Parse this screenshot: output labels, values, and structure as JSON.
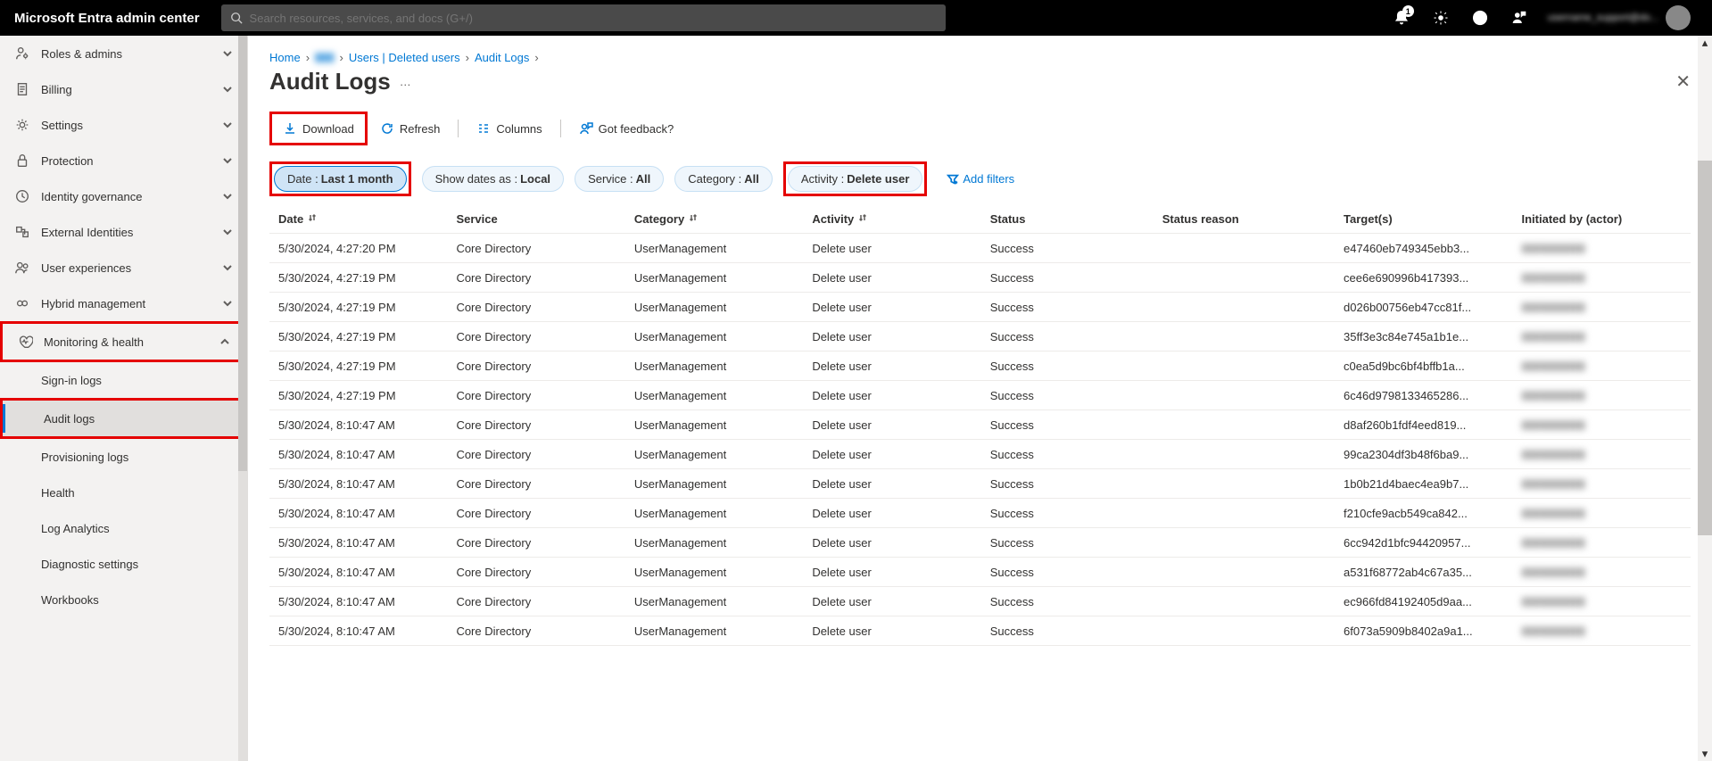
{
  "app_title": "Microsoft Entra admin center",
  "search_placeholder": "Search resources, services, and docs (G+/)",
  "notification_count": "1",
  "sidebar": {
    "items": [
      {
        "label": "Roles & admins",
        "icon": "user-gear",
        "expandable": true
      },
      {
        "label": "Billing",
        "icon": "receipt",
        "expandable": true
      },
      {
        "label": "Settings",
        "icon": "gear",
        "expandable": true
      },
      {
        "label": "Protection",
        "icon": "lock",
        "expandable": true
      },
      {
        "label": "Identity governance",
        "icon": "gavel",
        "expandable": true
      },
      {
        "label": "External Identities",
        "icon": "org",
        "expandable": true
      },
      {
        "label": "User experiences",
        "icon": "users",
        "expandable": true
      },
      {
        "label": "Hybrid management",
        "icon": "hybrid",
        "expandable": true
      },
      {
        "label": "Monitoring & health",
        "icon": "heartbeat",
        "expandable": true,
        "expanded": true,
        "highlighted": true
      },
      {
        "label": "Sign-in logs",
        "sub": true
      },
      {
        "label": "Audit logs",
        "sub": true,
        "selected": true,
        "highlighted": true
      },
      {
        "label": "Provisioning logs",
        "sub": true
      },
      {
        "label": "Health",
        "sub": true
      },
      {
        "label": "Log Analytics",
        "sub": true
      },
      {
        "label": "Diagnostic settings",
        "sub": true
      },
      {
        "label": "Workbooks",
        "sub": true
      }
    ]
  },
  "breadcrumb": [
    {
      "label": "Home"
    },
    {
      "label": "▮▮▮",
      "blurred": true
    },
    {
      "label": "Users | Deleted users"
    },
    {
      "label": "Audit Logs"
    }
  ],
  "page_title": "Audit Logs",
  "toolbar": {
    "download": "Download",
    "refresh": "Refresh",
    "columns": "Columns",
    "feedback": "Got feedback?"
  },
  "filters": {
    "date": {
      "label": "Date : ",
      "value": "Last 1 month",
      "highlighted": true
    },
    "show_dates": {
      "label": "Show dates as : ",
      "value": "Local"
    },
    "service": {
      "label": "Service : ",
      "value": "All"
    },
    "category": {
      "label": "Category : ",
      "value": "All"
    },
    "activity": {
      "label": "Activity : ",
      "value": "Delete user",
      "highlighted": true
    },
    "add": "Add filters"
  },
  "table": {
    "headers": [
      "Date",
      "Service",
      "Category",
      "Activity",
      "Status",
      "Status reason",
      "Target(s)",
      "Initiated by (actor)"
    ],
    "rows": [
      {
        "date": "5/30/2024, 4:27:20 PM",
        "service": "Core Directory",
        "category": "UserManagement",
        "activity": "Delete user",
        "status": "Success",
        "reason": "",
        "target": "e47460eb749345ebb3...",
        "actor": "▮▮▮▮▮▮▮▮▮▮"
      },
      {
        "date": "5/30/2024, 4:27:19 PM",
        "service": "Core Directory",
        "category": "UserManagement",
        "activity": "Delete user",
        "status": "Success",
        "reason": "",
        "target": "cee6e690996b417393...",
        "actor": "▮▮▮▮▮▮▮▮▮▮"
      },
      {
        "date": "5/30/2024, 4:27:19 PM",
        "service": "Core Directory",
        "category": "UserManagement",
        "activity": "Delete user",
        "status": "Success",
        "reason": "",
        "target": "d026b00756eb47cc81f...",
        "actor": "▮▮▮▮▮▮▮▮▮▮"
      },
      {
        "date": "5/30/2024, 4:27:19 PM",
        "service": "Core Directory",
        "category": "UserManagement",
        "activity": "Delete user",
        "status": "Success",
        "reason": "",
        "target": "35ff3e3c84e745a1b1e...",
        "actor": "▮▮▮▮▮▮▮▮▮▮"
      },
      {
        "date": "5/30/2024, 4:27:19 PM",
        "service": "Core Directory",
        "category": "UserManagement",
        "activity": "Delete user",
        "status": "Success",
        "reason": "",
        "target": "c0ea5d9bc6bf4bffb1a...",
        "actor": "▮▮▮▮▮▮▮▮▮▮"
      },
      {
        "date": "5/30/2024, 4:27:19 PM",
        "service": "Core Directory",
        "category": "UserManagement",
        "activity": "Delete user",
        "status": "Success",
        "reason": "",
        "target": "6c46d9798133465286...",
        "actor": "▮▮▮▮▮▮▮▮▮▮"
      },
      {
        "date": "5/30/2024, 8:10:47 AM",
        "service": "Core Directory",
        "category": "UserManagement",
        "activity": "Delete user",
        "status": "Success",
        "reason": "",
        "target": "d8af260b1fdf4eed819...",
        "actor": "▮▮▮▮▮▮▮▮▮▮"
      },
      {
        "date": "5/30/2024, 8:10:47 AM",
        "service": "Core Directory",
        "category": "UserManagement",
        "activity": "Delete user",
        "status": "Success",
        "reason": "",
        "target": "99ca2304df3b48f6ba9...",
        "actor": "▮▮▮▮▮▮▮▮▮▮"
      },
      {
        "date": "5/30/2024, 8:10:47 AM",
        "service": "Core Directory",
        "category": "UserManagement",
        "activity": "Delete user",
        "status": "Success",
        "reason": "",
        "target": "1b0b21d4baec4ea9b7...",
        "actor": "▮▮▮▮▮▮▮▮▮▮"
      },
      {
        "date": "5/30/2024, 8:10:47 AM",
        "service": "Core Directory",
        "category": "UserManagement",
        "activity": "Delete user",
        "status": "Success",
        "reason": "",
        "target": "f210cfe9acb549ca842...",
        "actor": "▮▮▮▮▮▮▮▮▮▮"
      },
      {
        "date": "5/30/2024, 8:10:47 AM",
        "service": "Core Directory",
        "category": "UserManagement",
        "activity": "Delete user",
        "status": "Success",
        "reason": "",
        "target": "6cc942d1bfc94420957...",
        "actor": "▮▮▮▮▮▮▮▮▮▮"
      },
      {
        "date": "5/30/2024, 8:10:47 AM",
        "service": "Core Directory",
        "category": "UserManagement",
        "activity": "Delete user",
        "status": "Success",
        "reason": "",
        "target": "a531f68772ab4c67a35...",
        "actor": "▮▮▮▮▮▮▮▮▮▮"
      },
      {
        "date": "5/30/2024, 8:10:47 AM",
        "service": "Core Directory",
        "category": "UserManagement",
        "activity": "Delete user",
        "status": "Success",
        "reason": "",
        "target": "ec966fd84192405d9aa...",
        "actor": "▮▮▮▮▮▮▮▮▮▮"
      },
      {
        "date": "5/30/2024, 8:10:47 AM",
        "service": "Core Directory",
        "category": "UserManagement",
        "activity": "Delete user",
        "status": "Success",
        "reason": "",
        "target": "6f073a5909b8402a9a1...",
        "actor": "▮▮▮▮▮▮▮▮▮▮"
      }
    ]
  }
}
